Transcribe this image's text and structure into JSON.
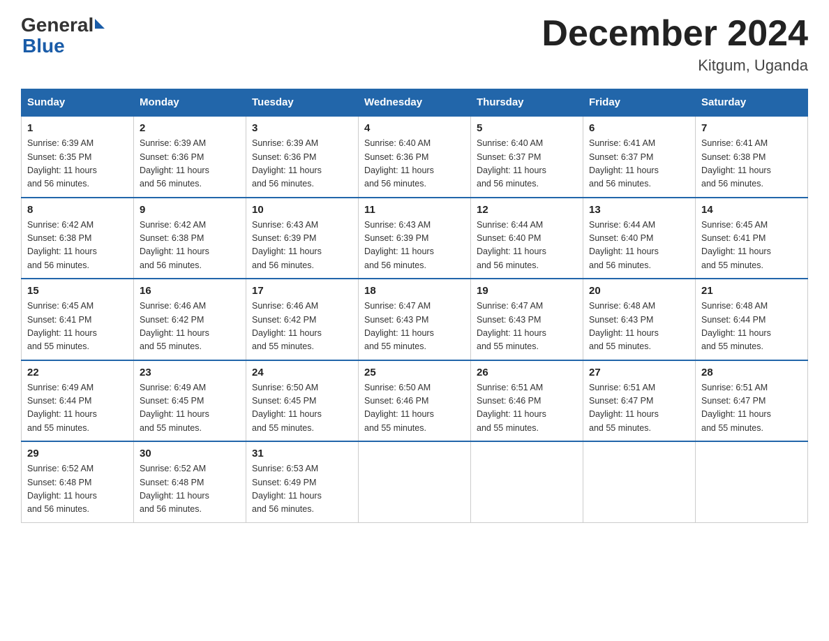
{
  "logo": {
    "text_general": "General",
    "text_blue": "Blue"
  },
  "title": {
    "month_year": "December 2024",
    "location": "Kitgum, Uganda"
  },
  "header_days": [
    "Sunday",
    "Monday",
    "Tuesday",
    "Wednesday",
    "Thursday",
    "Friday",
    "Saturday"
  ],
  "weeks": [
    [
      {
        "day": 1,
        "sunrise": "6:39 AM",
        "sunset": "6:35 PM",
        "daylight": "11 hours and 56 minutes."
      },
      {
        "day": 2,
        "sunrise": "6:39 AM",
        "sunset": "6:36 PM",
        "daylight": "11 hours and 56 minutes."
      },
      {
        "day": 3,
        "sunrise": "6:39 AM",
        "sunset": "6:36 PM",
        "daylight": "11 hours and 56 minutes."
      },
      {
        "day": 4,
        "sunrise": "6:40 AM",
        "sunset": "6:36 PM",
        "daylight": "11 hours and 56 minutes."
      },
      {
        "day": 5,
        "sunrise": "6:40 AM",
        "sunset": "6:37 PM",
        "daylight": "11 hours and 56 minutes."
      },
      {
        "day": 6,
        "sunrise": "6:41 AM",
        "sunset": "6:37 PM",
        "daylight": "11 hours and 56 minutes."
      },
      {
        "day": 7,
        "sunrise": "6:41 AM",
        "sunset": "6:38 PM",
        "daylight": "11 hours and 56 minutes."
      }
    ],
    [
      {
        "day": 8,
        "sunrise": "6:42 AM",
        "sunset": "6:38 PM",
        "daylight": "11 hours and 56 minutes."
      },
      {
        "day": 9,
        "sunrise": "6:42 AM",
        "sunset": "6:38 PM",
        "daylight": "11 hours and 56 minutes."
      },
      {
        "day": 10,
        "sunrise": "6:43 AM",
        "sunset": "6:39 PM",
        "daylight": "11 hours and 56 minutes."
      },
      {
        "day": 11,
        "sunrise": "6:43 AM",
        "sunset": "6:39 PM",
        "daylight": "11 hours and 56 minutes."
      },
      {
        "day": 12,
        "sunrise": "6:44 AM",
        "sunset": "6:40 PM",
        "daylight": "11 hours and 56 minutes."
      },
      {
        "day": 13,
        "sunrise": "6:44 AM",
        "sunset": "6:40 PM",
        "daylight": "11 hours and 56 minutes."
      },
      {
        "day": 14,
        "sunrise": "6:45 AM",
        "sunset": "6:41 PM",
        "daylight": "11 hours and 55 minutes."
      }
    ],
    [
      {
        "day": 15,
        "sunrise": "6:45 AM",
        "sunset": "6:41 PM",
        "daylight": "11 hours and 55 minutes."
      },
      {
        "day": 16,
        "sunrise": "6:46 AM",
        "sunset": "6:42 PM",
        "daylight": "11 hours and 55 minutes."
      },
      {
        "day": 17,
        "sunrise": "6:46 AM",
        "sunset": "6:42 PM",
        "daylight": "11 hours and 55 minutes."
      },
      {
        "day": 18,
        "sunrise": "6:47 AM",
        "sunset": "6:43 PM",
        "daylight": "11 hours and 55 minutes."
      },
      {
        "day": 19,
        "sunrise": "6:47 AM",
        "sunset": "6:43 PM",
        "daylight": "11 hours and 55 minutes."
      },
      {
        "day": 20,
        "sunrise": "6:48 AM",
        "sunset": "6:43 PM",
        "daylight": "11 hours and 55 minutes."
      },
      {
        "day": 21,
        "sunrise": "6:48 AM",
        "sunset": "6:44 PM",
        "daylight": "11 hours and 55 minutes."
      }
    ],
    [
      {
        "day": 22,
        "sunrise": "6:49 AM",
        "sunset": "6:44 PM",
        "daylight": "11 hours and 55 minutes."
      },
      {
        "day": 23,
        "sunrise": "6:49 AM",
        "sunset": "6:45 PM",
        "daylight": "11 hours and 55 minutes."
      },
      {
        "day": 24,
        "sunrise": "6:50 AM",
        "sunset": "6:45 PM",
        "daylight": "11 hours and 55 minutes."
      },
      {
        "day": 25,
        "sunrise": "6:50 AM",
        "sunset": "6:46 PM",
        "daylight": "11 hours and 55 minutes."
      },
      {
        "day": 26,
        "sunrise": "6:51 AM",
        "sunset": "6:46 PM",
        "daylight": "11 hours and 55 minutes."
      },
      {
        "day": 27,
        "sunrise": "6:51 AM",
        "sunset": "6:47 PM",
        "daylight": "11 hours and 55 minutes."
      },
      {
        "day": 28,
        "sunrise": "6:51 AM",
        "sunset": "6:47 PM",
        "daylight": "11 hours and 55 minutes."
      }
    ],
    [
      {
        "day": 29,
        "sunrise": "6:52 AM",
        "sunset": "6:48 PM",
        "daylight": "11 hours and 56 minutes."
      },
      {
        "day": 30,
        "sunrise": "6:52 AM",
        "sunset": "6:48 PM",
        "daylight": "11 hours and 56 minutes."
      },
      {
        "day": 31,
        "sunrise": "6:53 AM",
        "sunset": "6:49 PM",
        "daylight": "11 hours and 56 minutes."
      },
      null,
      null,
      null,
      null
    ]
  ],
  "labels": {
    "sunrise": "Sunrise:",
    "sunset": "Sunset:",
    "daylight": "Daylight:"
  }
}
